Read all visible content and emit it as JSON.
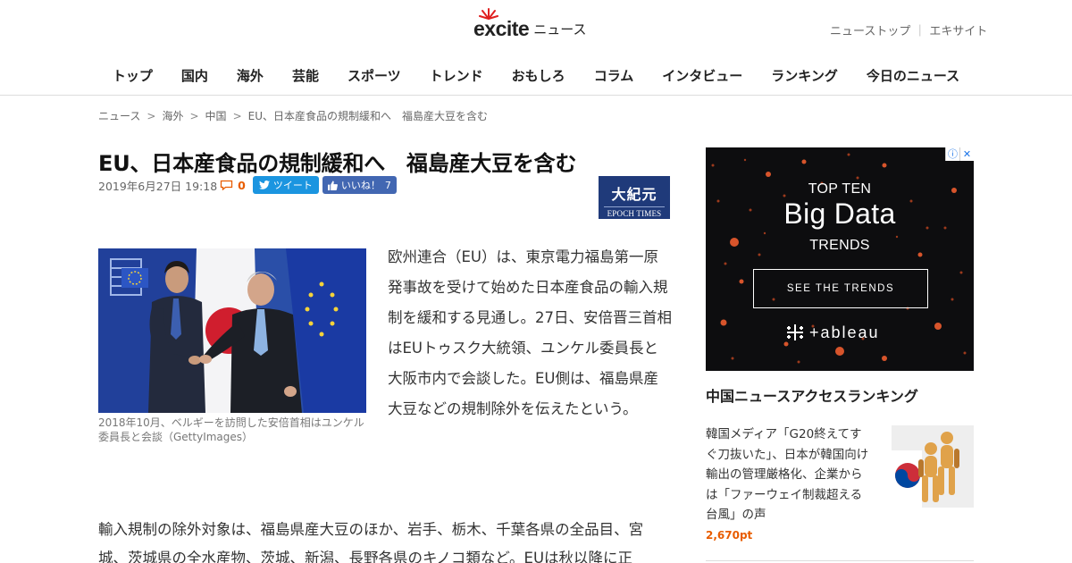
{
  "header": {
    "logo_text": "excite",
    "logo_suffix": "ニュース",
    "top_links": [
      "ニューストップ",
      "エキサイト"
    ],
    "top_link_separator": "｜",
    "nav": [
      "トップ",
      "国内",
      "海外",
      "芸能",
      "スポーツ",
      "トレンド",
      "おもしろ",
      "コラム",
      "インタビュー",
      "ランキング",
      "今日のニュース"
    ]
  },
  "breadcrumb": {
    "separator": ">",
    "items": [
      "ニュース",
      "海外",
      "中国",
      "EU、日本産食品の規制緩和へ　福島産大豆を含む"
    ]
  },
  "article": {
    "title": "EU、日本産食品の規制緩和へ　福島産大豆を含む",
    "date": "2019年6月27日 19:18",
    "comment_count": "0",
    "tweet_label": "ツイート",
    "like_label": "いいね！",
    "like_count": "7",
    "source_logo": {
      "jp": "大紀元",
      "en": "EPOCH TIMES"
    },
    "photo_caption": "2018年10月、ベルギーを訪問した安倍首相はユンケル委員長と会談（GettyImages）",
    "lead": "欧州連合（EU）は、東京電力福島第一原発事故を受けて始めた日本産食品の輸入規制を緩和する見通し。27日、安倍晋三首相はEUトゥスク大統領、ユンケル委員長と大阪市内で会談した。EU側は、福島県産大豆などの規制除外を伝えたという。",
    "body": "輸入規制の除外対象は、福島県産大豆のほか、岩手、栃木、千葉各県の全品目、宮城、茨城県の全水産物、茨城、新潟、長野各県のキノコ類など。EUは秋以降に正"
  },
  "ad": {
    "close_icons": [
      "info-icon",
      "close-icon"
    ],
    "line1": "TOP TEN",
    "line2": "Big Data",
    "line3": "TRENDS",
    "button": "SEE THE TRENDS",
    "brand": "+ableau"
  },
  "ranking": {
    "title": "中国ニュースアクセスランキング",
    "items": [
      {
        "text": "韓国メディア「G20終えてすぐ刀抜いた」、日本が韓国向け輸出の管理厳格化、企業からは「ファーウェイ制裁超える台風」の声",
        "points": "2,670pt"
      }
    ]
  },
  "colors": {
    "accent_orange": "#e85c00",
    "twitter_blue": "#1b95e0",
    "facebook_blue": "#4267b2",
    "epoch_blue": "#1f3a7a",
    "ad_background": "#0d0d0f"
  }
}
